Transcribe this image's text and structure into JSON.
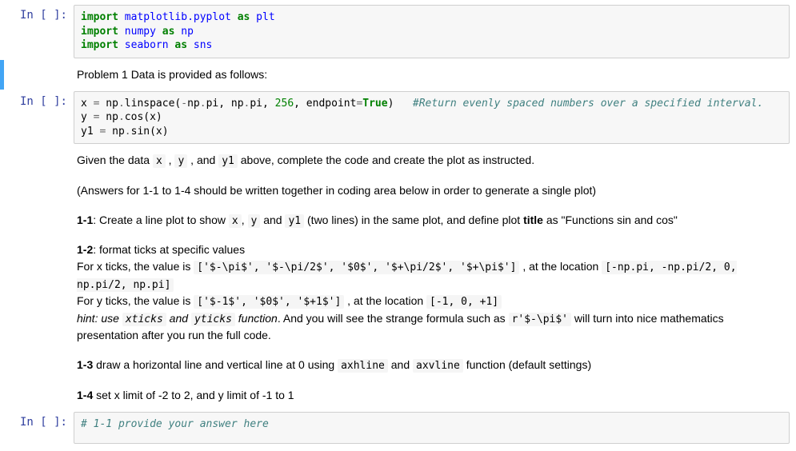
{
  "cells": {
    "c1": {
      "prompt": "In [ ]:",
      "code": {
        "l1": {
          "kw": "import",
          "mod": "matplotlib.pyplot",
          "as": "as",
          "alias": "plt"
        },
        "l2": {
          "kw": "import",
          "mod": "numpy",
          "as": "as",
          "alias": "np"
        },
        "l3": {
          "kw": "import",
          "mod": "seaborn",
          "as": "as",
          "alias": "sns"
        }
      }
    },
    "c2": {
      "md": "Problem 1 Data is provided as follows:"
    },
    "c3": {
      "prompt": "In [ ]:",
      "l1": {
        "pre": "x ",
        "eq": "=",
        "post": " np",
        "dot": ".",
        "fn": "linspace(",
        "a1": "-",
        "a1b": "np",
        "a1c": ".",
        "a1d": "pi, np",
        "a1e": ".",
        "a1f": "pi, ",
        "num": "256",
        "a2": ", endpoint",
        "eq2": "=",
        "tval": "True",
        "close": ")   ",
        "comment": "#Return evenly spaced numbers over a specified interval."
      },
      "l2": {
        "pre": "y ",
        "eq": "=",
        "post": " np",
        "dot": ".",
        "fn": "cos(x)"
      },
      "l3": {
        "pre": "y1 ",
        "eq": "=",
        "post": " np",
        "dot": ".",
        "fn": "sin(x)"
      }
    },
    "c4": {
      "p1a": "Given the data ",
      "p1_x": "x",
      "p1b": " , ",
      "p1_y": "y",
      "p1c": " , and ",
      "p1_y1": "y1",
      "p1d": " above, complete the code and create the plot as instructed.",
      "p2": "(Answers for 1-1 to 1-4 should be written together in coding area below in order to generate a single plot)",
      "p3a": "1-1",
      "p3b": ": Create a line plot to show ",
      "p3_x": "x",
      "p3c": ", ",
      "p3_y": "y",
      "p3d": " and ",
      "p3_y1": "y1",
      "p3e": " (two lines) in the same plot, and define plot ",
      "p3f": "title",
      "p3g": " as \"Functions sin and cos\"",
      "p4a": "1-2",
      "p4b": ": format ticks at specific values",
      "p4c": "For x ticks, the value is ",
      "p4_xv": "['$-\\pi$', '$-\\pi/2$', '$0$', '$+\\pi/2$', '$+\\pi$']",
      "p4d": " , at the location ",
      "p4_xl": "[-np.pi, -np.pi/2, 0, np.pi/2, np.pi]",
      "p4e": "For y ticks, the value is ",
      "p4_yv": "['$-1$', '$0$', '$+1$']",
      "p4f": " , at the location ",
      "p4_yl": "[-1, 0, +1]",
      "p4g": "hint: use ",
      "p4_xt": "xticks",
      "p4h": " and ",
      "p4_yt": "yticks",
      "p4i": " function",
      "p4j": ". And you will see the strange formula such as ",
      "p4_rf": "r'$-\\pi$'",
      "p4k": " will turn into nice mathematics presentation after you run the full code.",
      "p5a": "1-3",
      "p5b": " draw a horizontal line and vertical line at 0 using ",
      "p5_ah": "axhline",
      "p5c": " and ",
      "p5_av": "axvline",
      "p5d": " function (default settings)",
      "p6a": "1-4",
      "p6b": " set x limit of -2 to 2, and y limit of -1 to 1"
    },
    "c5": {
      "prompt": "In [ ]:",
      "comment": "# 1-1 provide your answer here"
    }
  }
}
